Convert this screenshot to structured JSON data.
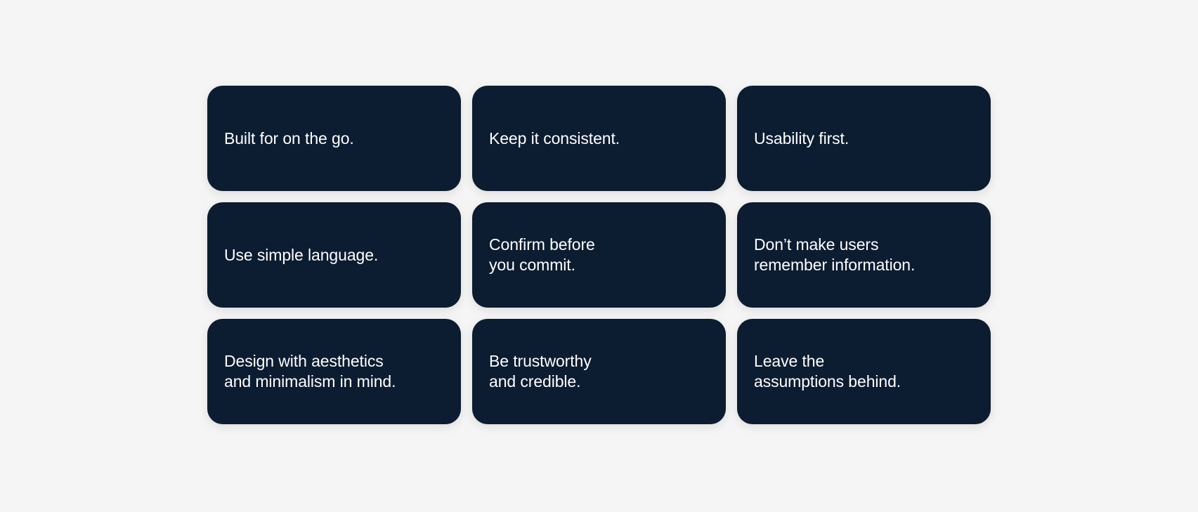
{
  "cards": [
    {
      "text": "Built for on the go."
    },
    {
      "text": "Keep it consistent."
    },
    {
      "text": "Usability first."
    },
    {
      "text": "Use simple language."
    },
    {
      "text": "Confirm before\nyou commit."
    },
    {
      "text": "Don’t make users\nremember information."
    },
    {
      "text": "Design with aesthetics\nand minimalism in mind."
    },
    {
      "text": "Be trustworthy\nand credible."
    },
    {
      "text": "Leave the\nassumptions behind."
    }
  ],
  "colors": {
    "background": "#f5f5f5",
    "card": "#0c1c31",
    "text": "#ffffff"
  }
}
